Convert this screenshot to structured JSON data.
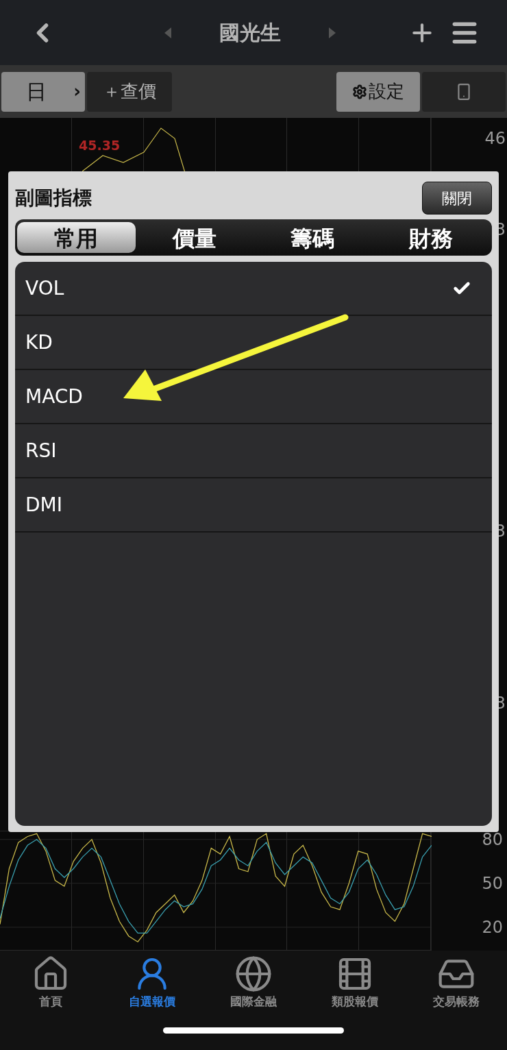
{
  "header": {
    "title": "國光生"
  },
  "toolbar": {
    "period": "日",
    "period_arrow": "›",
    "add_quote": "＋查價",
    "settings": "設定"
  },
  "chart": {
    "price_label": "45.35",
    "axis_labels": [
      "46",
      "3",
      "3",
      "3"
    ],
    "oscillator": {
      "chart_data": {
        "type": "line",
        "ylim": [
          4,
          86
        ],
        "grid": true,
        "yticks": [
          {
            "value": 20,
            "label": "20"
          },
          {
            "value": 50,
            "label": "50"
          },
          {
            "value": 80,
            "label": "80"
          }
        ],
        "series": [
          {
            "color": "#c8b84a",
            "values": [
              22,
              60,
              78,
              82,
              84,
              72,
              52,
              48,
              65,
              74,
              80,
              64,
              40,
              24,
              14,
              10,
              18,
              30,
              36,
              42,
              30,
              38,
              52,
              74,
              70,
              82,
              60,
              58,
              80,
              84,
              55,
              48,
              70,
              76,
              62,
              44,
              34,
              32,
              50,
              72,
              70,
              46,
              30,
              24,
              36,
              60,
              84,
              82
            ]
          },
          {
            "color": "#3aa0b0",
            "values": [
              26,
              48,
              66,
              76,
              80,
              74,
              60,
              54,
              60,
              68,
              74,
              68,
              52,
              36,
              24,
              16,
              16,
              24,
              32,
              38,
              34,
              36,
              46,
              62,
              66,
              74,
              66,
              62,
              72,
              78,
              64,
              56,
              62,
              68,
              64,
              52,
              40,
              36,
              44,
              60,
              66,
              56,
              42,
              32,
              34,
              48,
              68,
              76
            ]
          }
        ]
      }
    }
  },
  "modal": {
    "title": "副圖指標",
    "close": "關閉",
    "tabs": [
      {
        "label": "常用",
        "selected": true
      },
      {
        "label": "價量",
        "selected": false
      },
      {
        "label": "籌碼",
        "selected": false
      },
      {
        "label": "財務",
        "selected": false
      }
    ],
    "items": [
      {
        "label": "VOL",
        "checked": true
      },
      {
        "label": "KD",
        "checked": false
      },
      {
        "label": "MACD",
        "checked": false
      },
      {
        "label": "RSI",
        "checked": false
      },
      {
        "label": "DMI",
        "checked": false
      }
    ]
  },
  "nav": [
    {
      "label": "首頁",
      "selected": false
    },
    {
      "label": "自選報價",
      "selected": true
    },
    {
      "label": "國際金融",
      "selected": false
    },
    {
      "label": "類股報價",
      "selected": false
    },
    {
      "label": "交易帳務",
      "selected": false
    }
  ]
}
